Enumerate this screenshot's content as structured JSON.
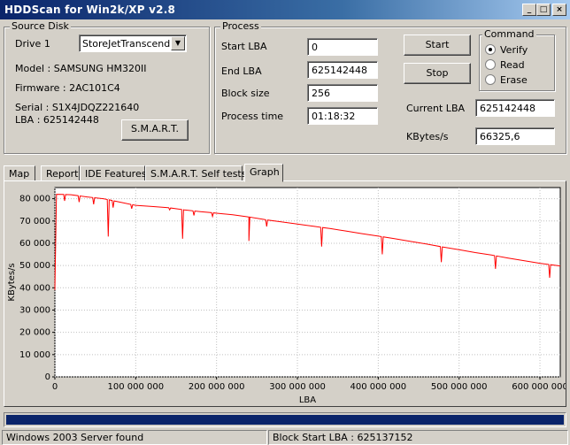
{
  "window": {
    "title": "HDDScan for Win2k/XP  v2.8",
    "minimize": "_",
    "maximize": "□",
    "close": "×"
  },
  "source_disk": {
    "group_label": "Source Disk",
    "drive_label": "Drive  1",
    "drive_value": "StoreJetTranscend",
    "model": "Model : SAMSUNG HM320II",
    "firmware": "Firmware : 2AC101C4",
    "serial": "Serial : S1X4JDQZ221640",
    "lba": "LBA :  625142448",
    "smart_button": "S.M.A.R.T."
  },
  "process": {
    "group_label": "Process",
    "start_lba_label": "Start LBA",
    "start_lba_value": "0",
    "end_lba_label": "End LBA",
    "end_lba_value": "625142448",
    "block_size_label": "Block size",
    "block_size_value": "256",
    "process_time_label": "Process time",
    "process_time_value": "01:18:32",
    "start_button": "Start",
    "stop_button": "Stop",
    "current_lba_label": "Current LBA",
    "current_lba_value": "625142448",
    "kbytes_label": "KBytes/s",
    "kbytes_value": "66325,6"
  },
  "command": {
    "group_label": "Command",
    "options": [
      "Verify",
      "Read",
      "Erase"
    ],
    "selected": "Verify"
  },
  "tabs": [
    "Map",
    "Report",
    "IDE Features",
    "S.M.A.R.T. Self tests",
    "Graph"
  ],
  "active_tab": "Graph",
  "progress": {
    "fraction": 1.0
  },
  "status": {
    "left": "Windows 2003 Server found",
    "right": "Block Start LBA : 625137152"
  },
  "colors": {
    "line": "#ff0000",
    "title_start": "#0a246a",
    "progress": "#0a246a"
  },
  "chart_data": {
    "type": "line",
    "xlabel": "LBA",
    "ylabel": "KBytes/s",
    "xlim": [
      0,
      625142448
    ],
    "ylim": [
      0,
      85000
    ],
    "xticks": [
      0,
      100000000,
      200000000,
      300000000,
      400000000,
      500000000,
      600000000
    ],
    "xtick_labels": [
      "0",
      "100 000 000",
      "200 000 000",
      "300 000 000",
      "400 000 000",
      "500 000 000",
      "600 000 000"
    ],
    "yticks": [
      0,
      10000,
      20000,
      30000,
      40000,
      50000,
      60000,
      70000,
      80000
    ],
    "ytick_labels": [
      "0",
      "10 000",
      "20 000",
      "30 000",
      "40 000",
      "50 000",
      "60 000",
      "70 000",
      "80 000"
    ],
    "grid": true,
    "series": [
      {
        "baseline": [
          [
            0,
            39000
          ],
          [
            2000000,
            82000
          ],
          [
            20000000,
            81800
          ],
          [
            40000000,
            80800
          ],
          [
            60000000,
            80000
          ],
          [
            80000000,
            78500
          ],
          [
            100000000,
            77000
          ],
          [
            120000000,
            76500
          ],
          [
            140000000,
            76000
          ],
          [
            160000000,
            75000
          ],
          [
            180000000,
            74200
          ],
          [
            200000000,
            73500
          ],
          [
            220000000,
            72800
          ],
          [
            240000000,
            71800
          ],
          [
            260000000,
            70600
          ],
          [
            280000000,
            69600
          ],
          [
            300000000,
            68600
          ],
          [
            320000000,
            67600
          ],
          [
            340000000,
            66600
          ],
          [
            360000000,
            65500
          ],
          [
            380000000,
            64300
          ],
          [
            400000000,
            63200
          ],
          [
            420000000,
            62100
          ],
          [
            440000000,
            60800
          ],
          [
            460000000,
            59600
          ],
          [
            480000000,
            58300
          ],
          [
            500000000,
            57100
          ],
          [
            520000000,
            55800
          ],
          [
            540000000,
            54700
          ],
          [
            560000000,
            53400
          ],
          [
            580000000,
            52200
          ],
          [
            600000000,
            51000
          ],
          [
            625142448,
            49800
          ]
        ],
        "dips": [
          [
            12000000,
            79000
          ],
          [
            30000000,
            78500
          ],
          [
            48000000,
            77500
          ],
          [
            66000000,
            63000
          ],
          [
            72000000,
            76000
          ],
          [
            95000000,
            75500
          ],
          [
            142000000,
            75000
          ],
          [
            158000000,
            62000
          ],
          [
            172000000,
            72500
          ],
          [
            195000000,
            72000
          ],
          [
            240000000,
            61000
          ],
          [
            262000000,
            67500
          ],
          [
            330000000,
            58500
          ],
          [
            405000000,
            55000
          ],
          [
            478000000,
            51500
          ],
          [
            545000000,
            48500
          ],
          [
            612000000,
            44500
          ]
        ]
      }
    ]
  }
}
